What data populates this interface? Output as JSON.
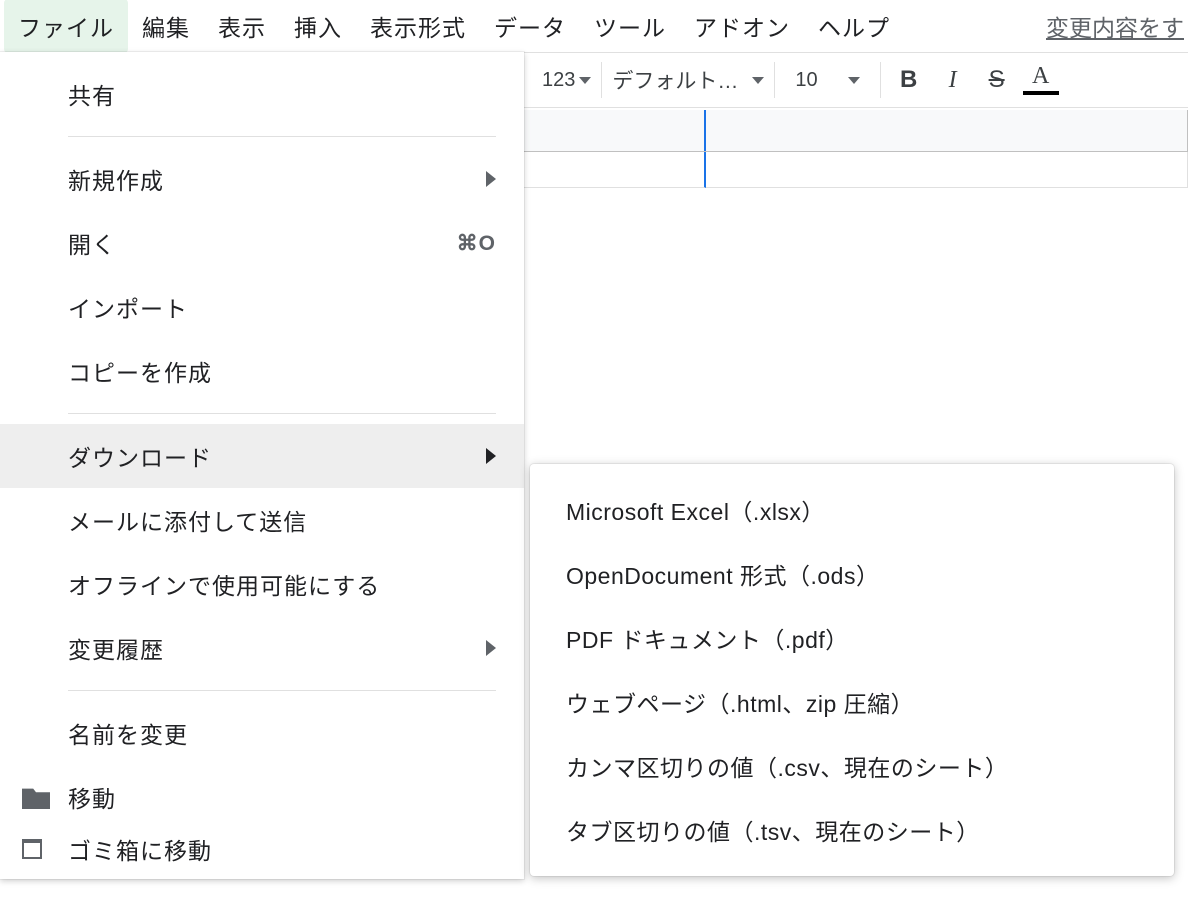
{
  "menubar": {
    "items": [
      "ファイル",
      "編集",
      "表示",
      "挿入",
      "表示形式",
      "データ",
      "ツール",
      "アドオン",
      "ヘルプ"
    ],
    "right_link": "変更内容をす"
  },
  "toolbar": {
    "number_format": "123",
    "font_name": "デフォルト…",
    "font_size": "10",
    "bold": "B",
    "italic": "I",
    "strike": "S",
    "text_color": "A"
  },
  "file_menu": {
    "share": "共有",
    "new": "新規作成",
    "open": "開く",
    "open_shortcut": "⌘O",
    "import": "インポート",
    "make_copy": "コピーを作成",
    "download": "ダウンロード",
    "email_attach": "メールに添付して送信",
    "offline": "オフラインで使用可能にする",
    "version_history": "変更履歴",
    "rename": "名前を変更",
    "move": "移動",
    "trash": "ゴミ箱に移動"
  },
  "download_submenu": {
    "items": [
      "Microsoft Excel（.xlsx）",
      "OpenDocument 形式（.ods）",
      "PDF ドキュメント（.pdf）",
      "ウェブページ（.html、zip 圧縮）",
      "カンマ区切りの値（.csv、現在のシート）",
      "タブ区切りの値（.tsv、現在のシート）"
    ]
  }
}
